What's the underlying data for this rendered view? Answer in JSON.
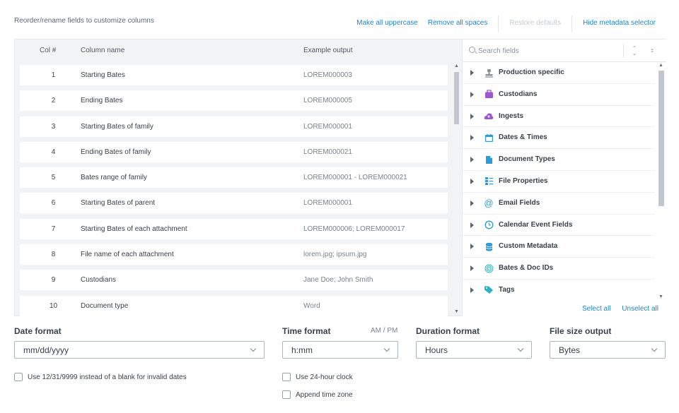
{
  "header": {
    "hint": "Reorder/rename fields to customize columns",
    "links": {
      "uppercase": "Make all uppercase",
      "remove_spaces": "Remove all spaces",
      "restore": "Restore defaults",
      "hide_selector": "Hide metadata selector"
    }
  },
  "table": {
    "headers": {
      "col": "Col #",
      "name": "Column name",
      "example": "Example output"
    },
    "rows": [
      {
        "num": "1",
        "name": "Starting Bates",
        "example": "LOREM000003"
      },
      {
        "num": "2",
        "name": "Ending Bates",
        "example": "LOREM000005"
      },
      {
        "num": "3",
        "name": "Starting Bates of family",
        "example": "LOREM000001"
      },
      {
        "num": "4",
        "name": "Ending Bates of family",
        "example": "LOREM000021"
      },
      {
        "num": "5",
        "name": "Bates range of family",
        "example": "LOREM000001 - LOREM000021"
      },
      {
        "num": "6",
        "name": "Starting Bates of parent",
        "example": "LOREM000001"
      },
      {
        "num": "7",
        "name": "Starting Bates of each attachment",
        "example": "LOREM000006; LOREM000017"
      },
      {
        "num": "8",
        "name": "File name of each attachment",
        "example": "lorem.jpg; ipsum.jpg"
      },
      {
        "num": "9",
        "name": "Custodians",
        "example": "Jane Doe; John Smith"
      },
      {
        "num": "10",
        "name": "Document type",
        "example": "Word"
      }
    ]
  },
  "selector": {
    "search_placeholder": "Search fields",
    "categories": [
      {
        "label": "Production specific",
        "icon": "stamp-icon"
      },
      {
        "label": "Custodians",
        "icon": "briefcase-icon"
      },
      {
        "label": "Ingests",
        "icon": "cloud-upload-icon"
      },
      {
        "label": "Dates & Times",
        "icon": "calendar-icon"
      },
      {
        "label": "Document Types",
        "icon": "document-icon"
      },
      {
        "label": "File Properties",
        "icon": "properties-icon"
      },
      {
        "label": "Email Fields",
        "icon": "at-sign-icon"
      },
      {
        "label": "Calendar Event Fields",
        "icon": "clock-icon"
      },
      {
        "label": "Custom Metadata",
        "icon": "database-icon"
      },
      {
        "label": "Bates & Doc IDs",
        "icon": "fingerprint-icon"
      },
      {
        "label": "Tags",
        "icon": "tag-icon"
      }
    ],
    "select_all": "Select all",
    "unselect_all": "Unselect all"
  },
  "formats": {
    "date": {
      "label": "Date format",
      "value": "mm/dd/yyyy"
    },
    "time": {
      "label": "Time format",
      "value": "h:mm",
      "ampm": "AM / PM"
    },
    "duration": {
      "label": "Duration format",
      "value": "Hours"
    },
    "filesize": {
      "label": "File size output",
      "value": "Bytes"
    }
  },
  "options": {
    "invalid_dates": "Use 12/31/9999 instead of a blank for invalid dates",
    "clock24": "Use 24-hour clock",
    "timezone": "Append time zone"
  },
  "colors": {
    "link": "#1f86c6",
    "panel_bg": "#f2f3f5",
    "icon_purple": "#9b59d0",
    "icon_blue": "#2d9cdb",
    "icon_teal": "#2bb3c0"
  }
}
